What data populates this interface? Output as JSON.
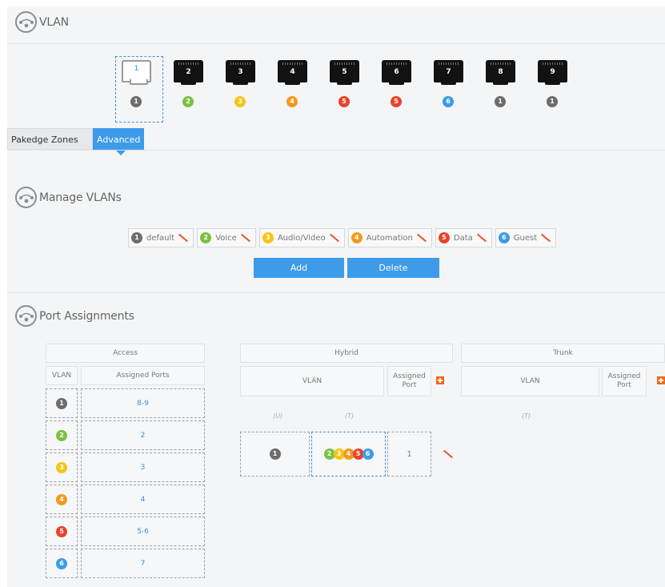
{
  "header": {
    "title": "VLAN"
  },
  "ports": [
    {
      "label": "1",
      "vlan": "1",
      "color": "#6d6d6d"
    },
    {
      "label": "2",
      "vlan": "2",
      "color": "#7cc142"
    },
    {
      "label": "3",
      "vlan": "3",
      "color": "#f5c518"
    },
    {
      "label": "4",
      "vlan": "4",
      "color": "#f39a1d"
    },
    {
      "label": "5",
      "vlan": "5",
      "color": "#e8442a"
    },
    {
      "label": "6",
      "vlan": "5",
      "color": "#e8442a"
    },
    {
      "label": "7",
      "vlan": "6",
      "color": "#3d9be9"
    },
    {
      "label": "8",
      "vlan": "1",
      "color": "#6d6d6d"
    },
    {
      "label": "9",
      "vlan": "1",
      "color": "#6d6d6d"
    }
  ],
  "tabs": {
    "pakedge_zones": "Pakedge Zones",
    "advanced": "Advanced"
  },
  "manage": {
    "title": "Manage VLANs",
    "vlans": [
      {
        "id": "1",
        "name": "default",
        "color": "#6d6d6d"
      },
      {
        "id": "2",
        "name": "Voice",
        "color": "#7cc142"
      },
      {
        "id": "3",
        "name": "Audio/Video",
        "color": "#f5c518"
      },
      {
        "id": "4",
        "name": "Automation",
        "color": "#f39a1d"
      },
      {
        "id": "5",
        "name": "Data",
        "color": "#e8442a"
      },
      {
        "id": "6",
        "name": "Guest",
        "color": "#3d9be9"
      }
    ],
    "add_label": "Add",
    "delete_label": "Delete"
  },
  "assign": {
    "title": "Port Assignments",
    "access": {
      "header": "Access",
      "col_vlan": "VLAN",
      "col_ports": "Assigned Ports",
      "rows": [
        {
          "vlan": "1",
          "ports": "8-9"
        },
        {
          "vlan": "2",
          "ports": "2"
        },
        {
          "vlan": "3",
          "ports": "3"
        },
        {
          "vlan": "4",
          "ports": "4"
        },
        {
          "vlan": "5",
          "ports": "5-6"
        },
        {
          "vlan": "6",
          "ports": "7"
        }
      ]
    },
    "hybrid": {
      "header": "Hybrid",
      "col_vlan": "VLAN",
      "col_port": "Assigned Port",
      "untagged_label": "(U)",
      "tagged_label": "(T)",
      "row": {
        "untagged": "1",
        "tagged": [
          "2",
          "3",
          "4",
          "5",
          "6"
        ],
        "port": "1"
      }
    },
    "trunk": {
      "header": "Trunk",
      "col_vlan": "VLAN",
      "col_port": "Assigned Port",
      "tagged_label": "(T)"
    }
  }
}
